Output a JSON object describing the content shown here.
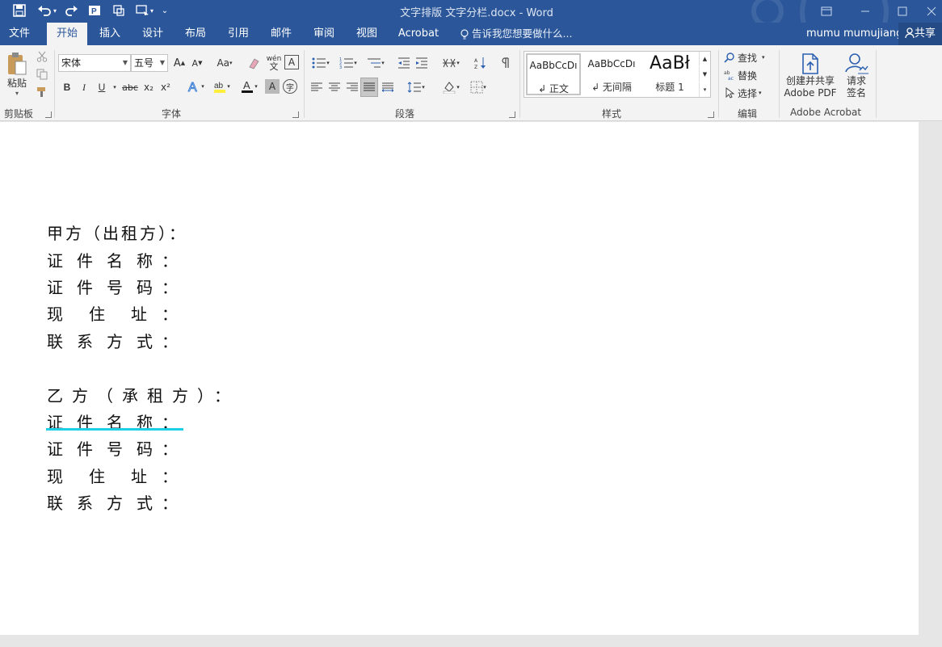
{
  "window": {
    "title": "文字排版   文字分栏.docx - Word"
  },
  "ribbon_tabs": [
    {
      "label": "文件"
    },
    {
      "label": "开始"
    },
    {
      "label": "插入"
    },
    {
      "label": "设计"
    },
    {
      "label": "布局"
    },
    {
      "label": "引用"
    },
    {
      "label": "邮件"
    },
    {
      "label": "审阅"
    },
    {
      "label": "视图"
    },
    {
      "label": "Acrobat"
    }
  ],
  "tell_me": "告诉我您想要做什么...",
  "user": "mumu mumujiang",
  "share": "共享",
  "clipboard": {
    "paste": "粘贴",
    "label": "剪贴板"
  },
  "font": {
    "name": "宋体",
    "size": "五号",
    "label": "字体",
    "bold": "B",
    "italic": "I",
    "underline": "U",
    "strike": "abc",
    "sub": "x₂",
    "sup": "x²",
    "grow": "A",
    "shrink": "A",
    "case": "Aa",
    "phonetic": "wén",
    "border": "A"
  },
  "paragraph": {
    "label": "段落"
  },
  "styles": {
    "label": "样式",
    "items": [
      {
        "sample": "AaBbCcDı",
        "name": "↲ 正文"
      },
      {
        "sample": "AaBbCcDı",
        "name": "↲ 无间隔"
      },
      {
        "sample": "AaBł",
        "name": "标题 1"
      }
    ]
  },
  "editing": {
    "label": "编辑",
    "find": "查找",
    "replace": "替换",
    "select": "选择"
  },
  "acrobat": {
    "label": "Adobe Acrobat",
    "create_line1": "创建并共享",
    "create_line2": "Adobe PDF",
    "sign_line1": "请求",
    "sign_line2": "签名"
  },
  "document": {
    "party_a": {
      "heading": "甲方（出租方）：",
      "fields": [
        {
          "chars": [
            "证",
            "件",
            "名",
            "称",
            "："
          ]
        },
        {
          "chars": [
            "证",
            "件",
            "号",
            "码",
            "："
          ]
        },
        {
          "chars": [
            "现",
            "住",
            "址",
            "："
          ]
        },
        {
          "chars": [
            "联",
            "系",
            "方",
            "式",
            "："
          ]
        }
      ]
    },
    "party_b": {
      "heading": "乙方（承租方）：",
      "fields": [
        {
          "chars": [
            "证",
            "件",
            "名",
            "称",
            "："
          ]
        },
        {
          "chars": [
            "证",
            "件",
            "号",
            "码",
            "："
          ]
        },
        {
          "chars": [
            "现",
            "住",
            "址",
            "："
          ]
        },
        {
          "chars": [
            "联",
            "系",
            "方",
            "式",
            "："
          ]
        }
      ]
    }
  },
  "colors": {
    "title_bar": "#2b579a",
    "underline_mark": "#1ccfe6"
  }
}
